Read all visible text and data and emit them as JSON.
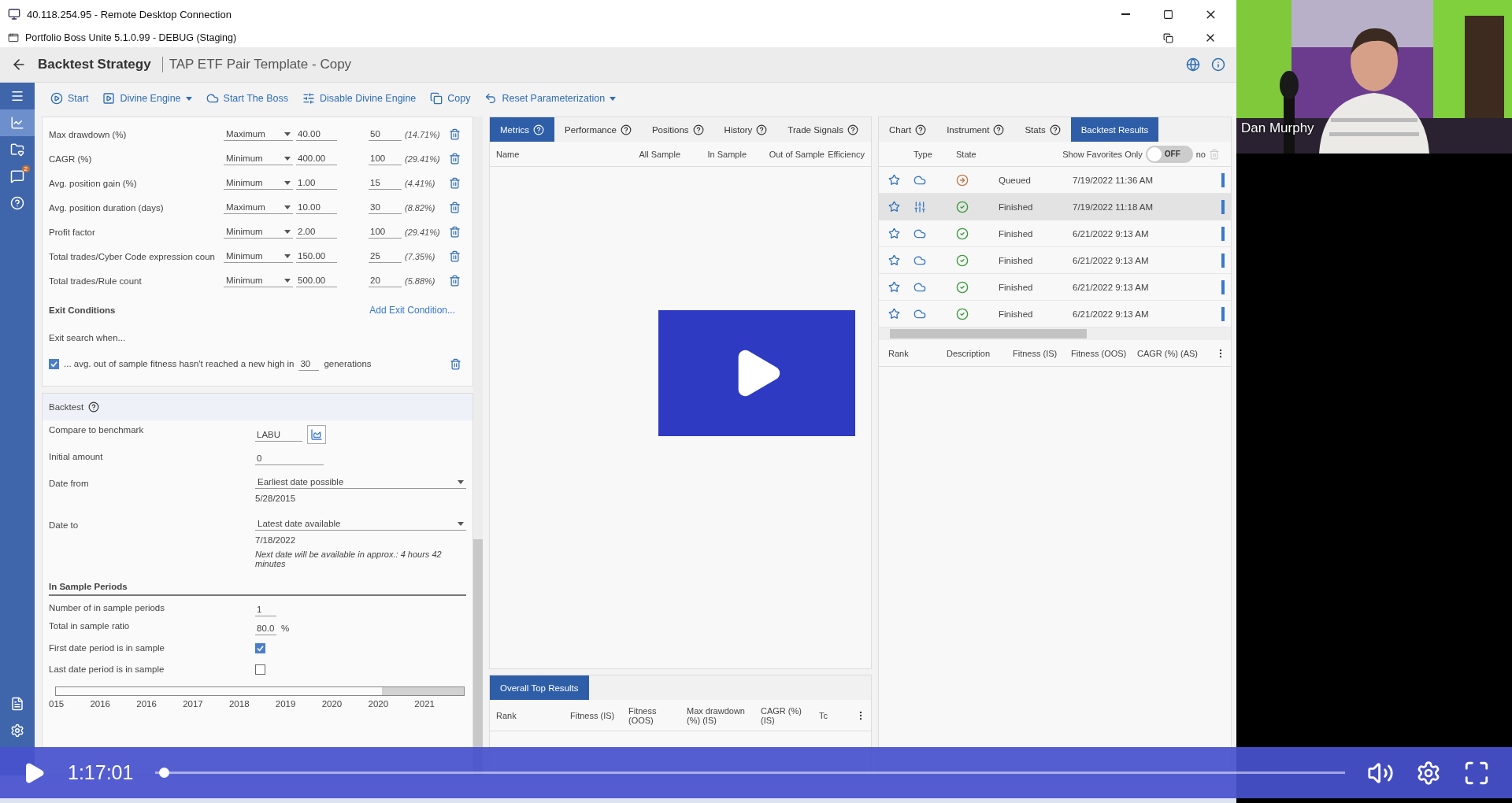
{
  "rdp_window": {
    "title": "40.118.254.95 - Remote Desktop Connection"
  },
  "app_window": {
    "title": "Portfolio Boss Unite 5.1.0.99 - DEBUG (Staging)"
  },
  "header": {
    "title": "Backtest Strategy",
    "subtitle": "TAP ETF Pair Template - Copy"
  },
  "sidebar": {
    "items": [
      {
        "kind": "menu",
        "selected": false
      },
      {
        "kind": "chart",
        "selected": true
      },
      {
        "kind": "favorites",
        "selected": false
      },
      {
        "kind": "notifications",
        "selected": false,
        "badge": "2"
      },
      {
        "kind": "help",
        "selected": false
      }
    ],
    "bottom_items": [
      {
        "kind": "document",
        "selected": false
      },
      {
        "kind": "settings",
        "selected": false
      }
    ]
  },
  "toolbar": [
    {
      "label": "Start",
      "kind": "play",
      "dropdown": false
    },
    {
      "label": "Divine Engine",
      "kind": "engine",
      "dropdown": true
    },
    {
      "label": "Start The Boss",
      "kind": "boss",
      "dropdown": false
    },
    {
      "label": "Disable Divine Engine",
      "kind": "disable",
      "dropdown": false
    },
    {
      "label": "Copy",
      "kind": "copy",
      "dropdown": false
    },
    {
      "label": "Reset Parameterization",
      "kind": "reset",
      "dropdown": true
    }
  ],
  "fitness_rows": [
    {
      "type": "Max drawdown (%)",
      "target": "Maximum",
      "value": "40.00",
      "weight": "50",
      "share": "(14.71%)"
    },
    {
      "type": "CAGR (%)",
      "target": "Minimum",
      "value": "400.00",
      "weight": "100",
      "share": "(29.41%)"
    },
    {
      "type": "Avg. position gain (%)",
      "target": "Minimum",
      "value": "1.00",
      "weight": "15",
      "share": "(4.41%)"
    },
    {
      "type": "Avg. position duration (days)",
      "target": "Maximum",
      "value": "10.00",
      "weight": "30",
      "share": "(8.82%)"
    },
    {
      "type": "Profit factor",
      "target": "Minimum",
      "value": "2.00",
      "weight": "100",
      "share": "(29.41%)"
    },
    {
      "type": "Total trades/Cyber Code expression coun",
      "target": "Minimum",
      "value": "150.00",
      "weight": "25",
      "share": "(7.35%)"
    },
    {
      "type": "Total trades/Rule count",
      "target": "Minimum",
      "value": "500.00",
      "weight": "20",
      "share": "(5.88%)"
    }
  ],
  "exit_conditions": {
    "title": "Exit Conditions",
    "add_link": "Add Exit Condition...",
    "intro": "Exit search when...",
    "items": [
      {
        "checked": true,
        "text": "... avg. out of sample fitness hasn't reached a new high in",
        "value": "30",
        "suffix": "generations"
      }
    ]
  },
  "backtest": {
    "title": "Backtest",
    "benchmark": {
      "label": "Compare to benchmark",
      "value": "LABU"
    },
    "initial_amount": {
      "label": "Initial amount",
      "value": "0"
    },
    "date_from": {
      "label": "Date from",
      "value": "Earliest date possible",
      "date": "5/28/2015"
    },
    "date_to": {
      "label": "Date to",
      "value": "Latest date available",
      "date": "7/18/2022",
      "note": "Next date will be available in approx.: 4 hours 42 minutes"
    },
    "in_sample": {
      "title": "In Sample Periods",
      "number": {
        "label": "Number of in sample periods",
        "value": "1"
      },
      "ratio": {
        "label": "Total in sample ratio",
        "value": "80.0",
        "unit": "%"
      },
      "checks": [
        {
          "label": "First date period is in sample",
          "checked": true
        },
        {
          "label": "Last date period is in sample",
          "checked": false
        }
      ],
      "timeline": {
        "level": 0.8,
        "years": [
          "015",
          "2016",
          "2016",
          "2017",
          "2018",
          "2019",
          "2020",
          "2020",
          "2021"
        ]
      }
    }
  },
  "metrics_panel": {
    "tabs": [
      {
        "label": "Metrics",
        "selected": true,
        "help": true
      },
      {
        "label": "Performance",
        "selected": false,
        "help": true
      },
      {
        "label": "Positions",
        "selected": false,
        "help": true
      },
      {
        "label": "History",
        "selected": false,
        "help": true
      },
      {
        "label": "Trade Signals",
        "selected": false,
        "help": true
      }
    ],
    "columns": [
      "Name",
      "All Sample",
      "In Sample",
      "Out of Sample",
      "Efficiency"
    ]
  },
  "top_results": {
    "tabs": [
      {
        "label": "Overall Top Results",
        "selected": true,
        "help": false
      }
    ],
    "columns": [
      "Rank",
      "Fitness (IS)",
      "Fitness (OOS)",
      "Max drawdown (%) (IS)",
      "CAGR (%) (IS)",
      "Tc"
    ]
  },
  "results_panel": {
    "tabs": [
      {
        "label": "Chart",
        "selected": false,
        "help": true
      },
      {
        "label": "Instrument",
        "selected": false,
        "help": true
      },
      {
        "label": "Stats",
        "selected": false,
        "help": true
      },
      {
        "label": "Backtest Results",
        "selected": true,
        "help": false
      }
    ],
    "columns": [
      "Type",
      "State"
    ],
    "favorites": {
      "label": "Show Favorites Only",
      "on": false,
      "state_label": "OFF"
    },
    "cut_column": "no",
    "rows": [
      {
        "type": {
          "kind": "cloud"
        },
        "state": {
          "kind": "queued",
          "label": "Queued"
        },
        "date": "7/19/2022 11:36 AM",
        "selected": false
      },
      {
        "type": {
          "kind": "sliders"
        },
        "state": {
          "kind": "finished",
          "label": "Finished"
        },
        "date": "7/19/2022 11:18 AM",
        "selected": true
      },
      {
        "type": {
          "kind": "cloud"
        },
        "state": {
          "kind": "finished",
          "label": "Finished"
        },
        "date": "6/21/2022 9:13 AM",
        "selected": false
      },
      {
        "type": {
          "kind": "cloud"
        },
        "state": {
          "kind": "finished",
          "label": "Finished"
        },
        "date": "6/21/2022 9:13 AM",
        "selected": false
      },
      {
        "type": {
          "kind": "cloud"
        },
        "state": {
          "kind": "finished",
          "label": "Finished"
        },
        "date": "6/21/2022 9:13 AM",
        "selected": false
      },
      {
        "type": {
          "kind": "cloud"
        },
        "state": {
          "kind": "finished",
          "label": "Finished"
        },
        "date": "6/21/2022 9:13 AM",
        "selected": false
      }
    ],
    "lower_columns": [
      "Rank",
      "Description",
      "Fitness (IS)",
      "Fitness (OOS)",
      "CAGR (%) (AS)"
    ]
  },
  "video": {
    "presenter": "Dan Murphy",
    "time": "1:17:01",
    "progress": {
      "level": 0.003
    }
  }
}
